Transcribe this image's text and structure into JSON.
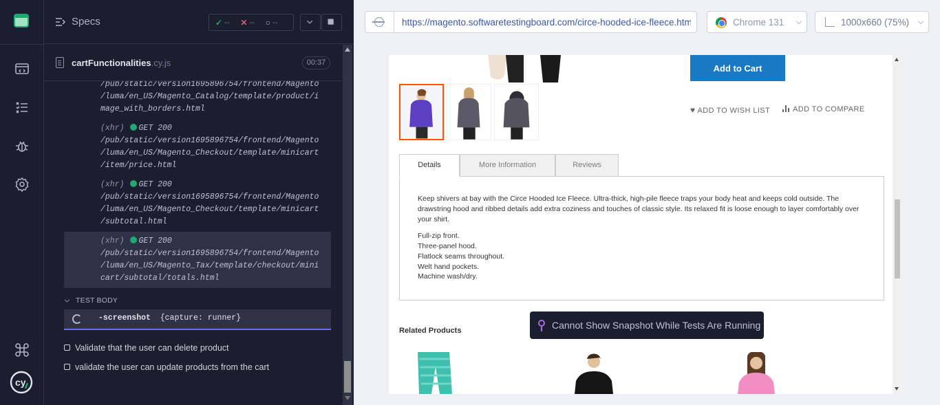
{
  "nav": {
    "items": [
      "specs-icon",
      "runs-icon",
      "debug-icon",
      "settings-icon"
    ],
    "keyboard_icon": "command-icon"
  },
  "reporter": {
    "title": "Specs",
    "stats": {
      "passed": "--",
      "failed": "--",
      "pending": "--"
    },
    "file": {
      "name": "cartFunctionalities",
      "ext": ".cy.js",
      "duration": "00:37"
    },
    "log": [
      {
        "lines": [
          "/pub/static/version1695896754/frontend/Magento",
          "/luma/en_US/Magento_Catalog/template/product/i",
          "mage_with_borders.html"
        ]
      },
      {
        "type": "(xhr)",
        "method": "GET 200",
        "lines": [
          "/pub/static/version1695896754/frontend/Magento",
          "/luma/en_US/Magento_Checkout/template/minicart",
          "/item/price.html"
        ]
      },
      {
        "type": "(xhr)",
        "method": "GET 200",
        "lines": [
          "/pub/static/version1695896754/frontend/Magento",
          "/luma/en_US/Magento_Checkout/template/minicart",
          "/subtotal.html"
        ]
      },
      {
        "type": "(xhr)",
        "method": "GET 200",
        "lines": [
          "/pub/static/version1695896754/frontend/Magento",
          "/luma/en_US/Magento_Tax/template/checkout/mini",
          "cart/subtotal/totals.html"
        ]
      }
    ],
    "test_body_label": "TEST BODY",
    "command": {
      "name": "-screenshot",
      "args": "{capture: runner}"
    },
    "tests": [
      "Validate that the user can delete product",
      "validate the user can update products from the cart"
    ]
  },
  "aut": {
    "url": "https://magento.softwaretestingboard.com/circe-hooded-ice-fleece.html",
    "browser": "Chrome 131",
    "viewport": "1000x660 (75%)",
    "page": {
      "add_to_cart": "Add to Cart",
      "wishlist": "ADD TO WISH LIST",
      "compare": "ADD TO COMPARE",
      "tabs": [
        "Details",
        "More Information",
        "Reviews"
      ],
      "description": "Keep shivers at bay with the Circe Hooded Ice Fleece. Ultra-thick, high-pile fleece traps your body heat and keeps cold outside. The drawstring hood and ribbed details add extra coziness and touches of classic style. Its relaxed fit is loose enough to layer comfortably over your shirt.",
      "features": [
        "Full-zip front.",
        "Three-panel hood.",
        "Flatlock seams throughout.",
        "Welt hand pockets.",
        "Machine wash/dry."
      ],
      "related_title": "Related Products"
    },
    "snapshot_message": "Cannot Show Snapshot While Tests Are Running"
  },
  "colors": {
    "accent": "#6470f3",
    "success": "#1fa971",
    "magento_blue": "#1979c3",
    "selected_thumb": "#ff5501"
  }
}
